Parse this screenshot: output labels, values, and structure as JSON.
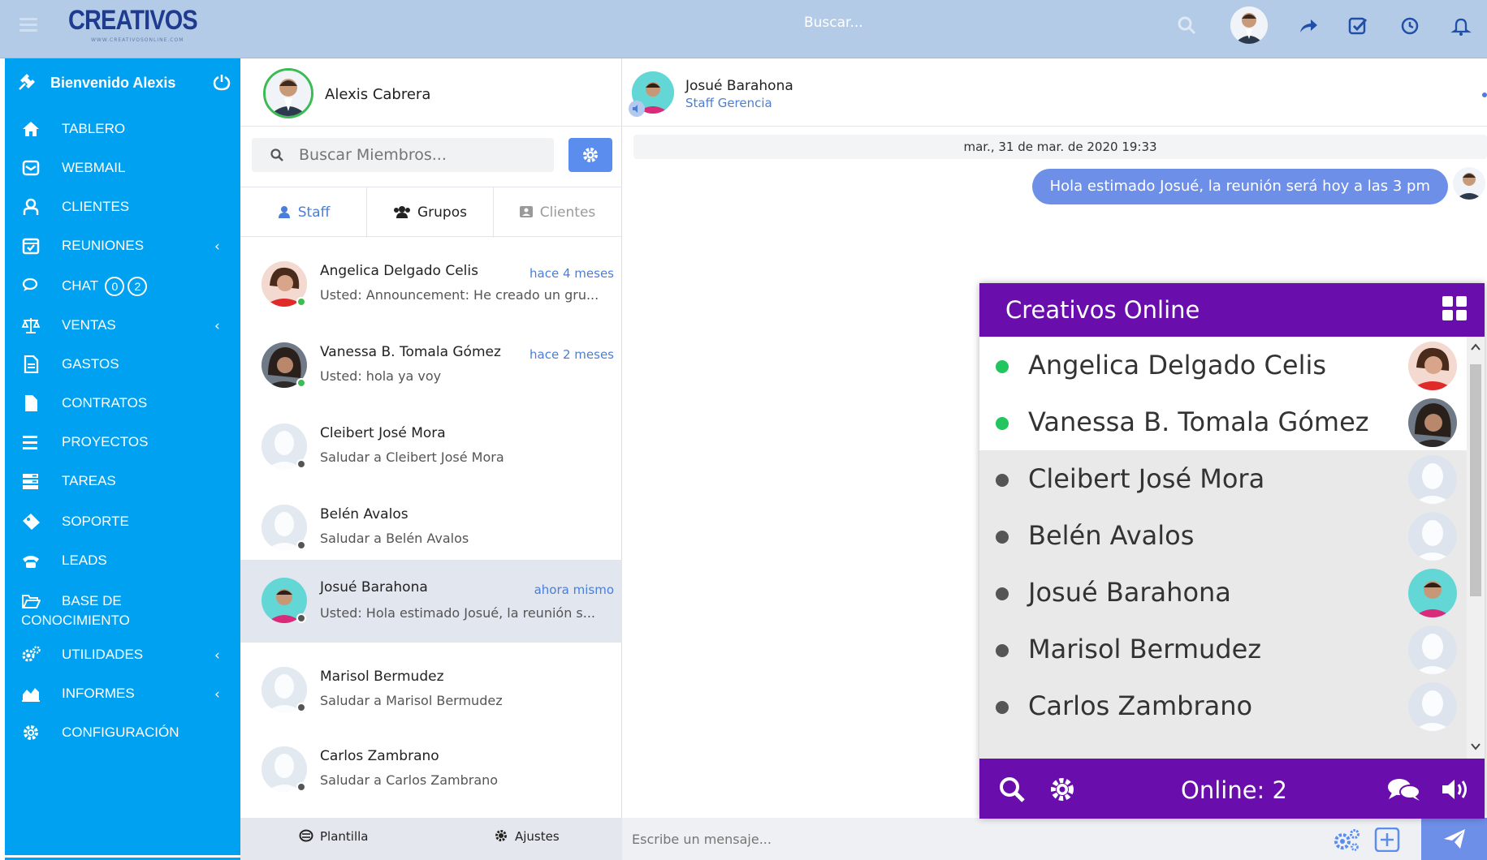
{
  "topbar": {
    "logo_text": "CREATIVOS",
    "logo_sub": "WWW.CREATIVOSONLINE.COM",
    "search_placeholder": "Buscar..."
  },
  "sidebar": {
    "welcome": "Bienvenido Alexis",
    "items": [
      {
        "label": "TABLERO",
        "icon": "home-icon"
      },
      {
        "label": "WEBMAIL",
        "icon": "mail-icon"
      },
      {
        "label": "CLIENTES",
        "icon": "user-icon"
      },
      {
        "label": "REUNIONES",
        "icon": "calendar-check-icon",
        "caret": "‹"
      },
      {
        "label": "CHAT",
        "icon": "chat-icon",
        "badges": [
          "0",
          "2"
        ]
      },
      {
        "label": "VENTAS",
        "icon": "balance-scale-icon",
        "caret": "‹"
      },
      {
        "label": "GASTOS",
        "icon": "file-text-icon"
      },
      {
        "label": "CONTRATOS",
        "icon": "file-icon"
      },
      {
        "label": "PROYECTOS",
        "icon": "bars-icon"
      },
      {
        "label": "TAREAS",
        "icon": "tasks-icon"
      },
      {
        "label": "SOPORTE",
        "icon": "ticket-icon"
      },
      {
        "label": "LEADS",
        "icon": "phone-icon"
      },
      {
        "label": "BASE DE",
        "label2": "CONOCIMIENTO",
        "icon": "folder-open-icon"
      },
      {
        "label": "UTILIDADES",
        "icon": "cogs-icon",
        "caret": "‹"
      },
      {
        "label": "INFORMES",
        "icon": "area-chart-icon",
        "caret": "‹"
      },
      {
        "label": "CONFIGURACIÓN",
        "icon": "cog-icon"
      }
    ]
  },
  "contacts": {
    "me_name": "Alexis Cabrera",
    "search_placeholder": "Buscar Miembros...",
    "tabs": [
      "Staff",
      "Grupos",
      "Clientes"
    ],
    "list": [
      {
        "name": "Angelica Delgado Celis",
        "time": "hace 4 meses",
        "message": "Usted: Announcement: He creado un gru...",
        "status": "online"
      },
      {
        "name": "Vanessa B. Tomala Gómez",
        "time": "hace 2 meses",
        "message": "Usted: hola ya voy",
        "status": "online"
      },
      {
        "name": "Cleibert José Mora",
        "time": "",
        "message": "Saludar a Cleibert José Mora",
        "status": "offline"
      },
      {
        "name": "Belén Avalos",
        "time": "",
        "message": "Saludar a Belén Avalos",
        "status": "offline"
      },
      {
        "name": "Josué Barahona",
        "time": "ahora mismo",
        "message": "Usted: Hola estimado Josué, la reunión s...",
        "status": "offline"
      },
      {
        "name": "Marisol Bermudez",
        "time": "",
        "message": "Saludar a Marisol Bermudez",
        "status": "offline"
      },
      {
        "name": "Carlos Zambrano",
        "time": "",
        "message": "Saludar a Carlos Zambrano",
        "status": "offline"
      }
    ],
    "footer": {
      "template": "Plantilla",
      "settings": "Ajustes"
    }
  },
  "conversation": {
    "name": "Josué Barahona",
    "role": "Staff Gerencia",
    "date": "mar., 31 de mar. de 2020 19:33",
    "message": "Hola estimado Josué, la reunión será hoy a las 3 pm",
    "composer_placeholder": "Escribe un mensaje..."
  },
  "widget": {
    "title": "Creativos Online",
    "rows": [
      {
        "name": "Angelica Delgado Celis",
        "status": "online"
      },
      {
        "name": "Vanessa B. Tomala Gómez",
        "status": "online"
      },
      {
        "name": "Cleibert José Mora",
        "status": "offline"
      },
      {
        "name": "Belén Avalos",
        "status": "offline"
      },
      {
        "name": "Josué Barahona",
        "status": "offline"
      },
      {
        "name": "Marisol Bermudez",
        "status": "offline"
      },
      {
        "name": "Carlos Zambrano",
        "status": "offline"
      }
    ],
    "online_label": "Online: 2"
  },
  "colors": {
    "sidebar": "#00a1f0",
    "topbar": "#b3cbe6",
    "accent": "#6e8fe8",
    "widget": "#6a0dad",
    "online": "#3cba54",
    "offline": "#555555",
    "link": "#4a7ed8"
  }
}
